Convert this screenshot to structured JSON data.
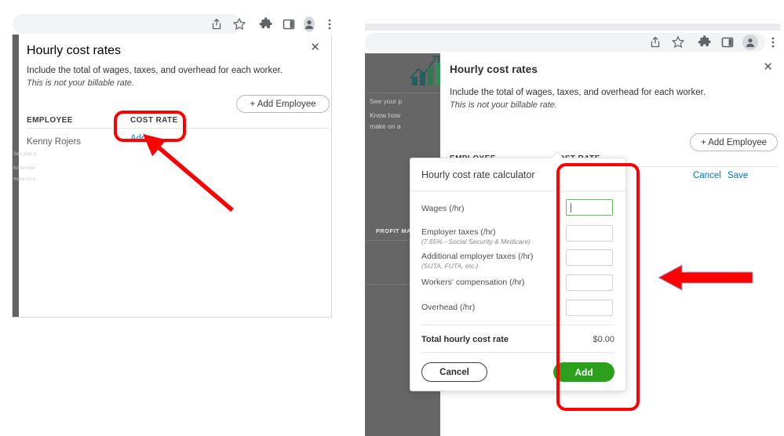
{
  "browser": {
    "toolbar_icons": [
      "share-icon",
      "bookmark-star-icon",
      "extensions-puzzle-icon",
      "side-panel-icon",
      "profile-avatar-icon",
      "browser-menu-kebab-icon"
    ],
    "omnibox_value": ""
  },
  "modal": {
    "title": "Hourly cost rates",
    "description": "Include the total of wages, taxes, and overhead for each worker.",
    "subnote": "This is not your billable rate.",
    "close_label": "✕",
    "add_employee_label": "+ Add Employee",
    "table": {
      "headers": [
        "EMPLOYEE",
        "COST RATE"
      ],
      "rows": [
        {
          "employee": "Kenny Rojers",
          "cost_rate_link": "Add",
          "cost_rate_value": ""
        }
      ]
    },
    "row_actions": {
      "cancel": "Cancel",
      "save": "Save"
    }
  },
  "calculator": {
    "title": "Hourly cost rate calculator",
    "fields": [
      {
        "label": "Wages (/hr)",
        "hint": "",
        "value": "",
        "focused": true
      },
      {
        "label": "Employer taxes (/hr)",
        "hint": "(7.65% - Social Security & Medicare)",
        "value": "",
        "focused": false
      },
      {
        "label": "Additional employer taxes (/hr)",
        "hint": "(SUTA, FUTA, etc.)",
        "value": "",
        "focused": false
      },
      {
        "label": "Workers' compensation (/hr)",
        "hint": "",
        "value": "",
        "focused": false
      },
      {
        "label": "Overhead (/hr)",
        "hint": "",
        "value": "",
        "focused": false
      }
    ],
    "total_label": "Total hourly cost rate",
    "total_value": "$0.00",
    "cancel_label": "Cancel",
    "add_label": "Add"
  },
  "background_page": {
    "line1": "See your p",
    "line2": "Know how",
    "line3": "make on a",
    "section_header": "PROFIT MA"
  },
  "annotations": {
    "left_highlight_target": "Add",
    "left_arrow": "red-arrow-pointing-up-left",
    "right_highlight_target": "calculator-inputs-and-add-button",
    "right_arrow": "red-arrow-pointing-left"
  },
  "colors": {
    "accent_green": "#2ca01c",
    "link_blue": "#0077c5",
    "annotation_red": "#ff0000",
    "dim_overlay": "#666666"
  }
}
